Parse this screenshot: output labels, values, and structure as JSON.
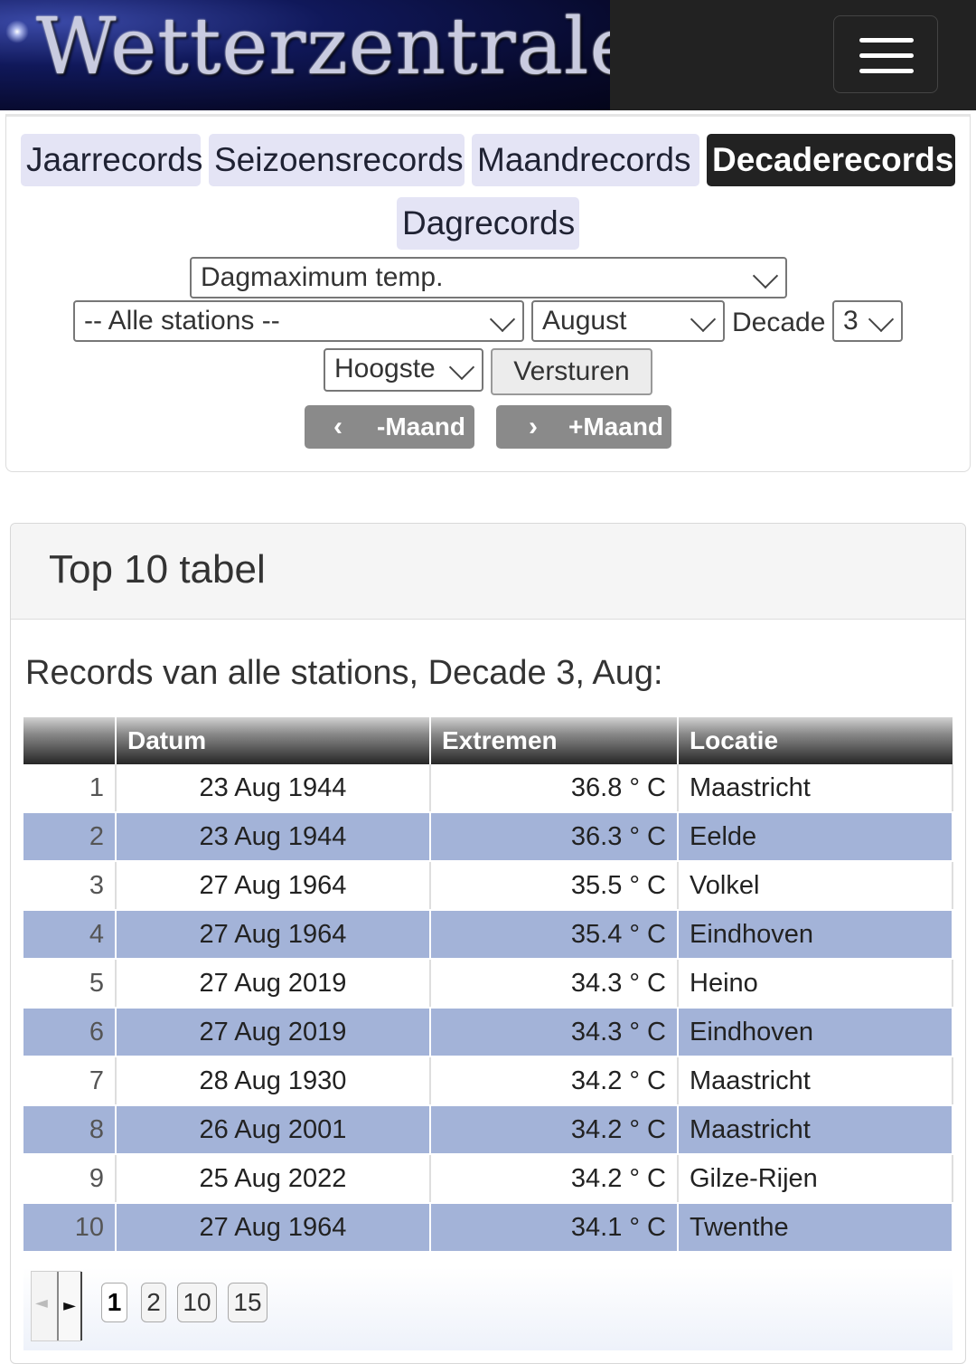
{
  "header": {
    "logo_text": "Wetterzentrale"
  },
  "tabs": [
    "Jaarrecords",
    "Seizoensrecords",
    "Maandrecords",
    "Decaderecords",
    "Dagrecords"
  ],
  "filters": {
    "parameter": "Dagmaximum temp.",
    "station": "-- Alle stations --",
    "month": "August",
    "decade_label": "Decade",
    "decade": "3",
    "order": "Hoogste",
    "submit": "Versturen",
    "prev_month": "-Maand",
    "next_month": "+Maand"
  },
  "panel": {
    "title": "Top 10 tabel",
    "subtitle": "Records van alle stations, Decade 3, Aug:"
  },
  "table": {
    "headers": [
      "",
      "Datum",
      "Extremen",
      "Locatie"
    ],
    "rows": [
      {
        "rank": "1",
        "datum": "23 Aug 1944",
        "value": "36.8 ° C",
        "locatie": "Maastricht"
      },
      {
        "rank": "2",
        "datum": "23 Aug 1944",
        "value": "36.3 ° C",
        "locatie": "Eelde"
      },
      {
        "rank": "3",
        "datum": "27 Aug 1964",
        "value": "35.5 ° C",
        "locatie": "Volkel"
      },
      {
        "rank": "4",
        "datum": "27 Aug 1964",
        "value": "35.4 ° C",
        "locatie": "Eindhoven"
      },
      {
        "rank": "5",
        "datum": "27 Aug 2019",
        "value": "34.3 ° C",
        "locatie": "Heino"
      },
      {
        "rank": "6",
        "datum": "27 Aug 2019",
        "value": "34.3 ° C",
        "locatie": "Eindhoven"
      },
      {
        "rank": "7",
        "datum": "28 Aug 1930",
        "value": "34.2 ° C",
        "locatie": "Maastricht"
      },
      {
        "rank": "8",
        "datum": "26 Aug 2001",
        "value": "34.2 ° C",
        "locatie": "Maastricht"
      },
      {
        "rank": "9",
        "datum": "25 Aug 2022",
        "value": "34.2 ° C",
        "locatie": "Gilze-Rijen"
      },
      {
        "rank": "10",
        "datum": "27 Aug 1964",
        "value": "34.1 ° C",
        "locatie": "Twenthe"
      }
    ]
  },
  "pager": {
    "page_sizes": [
      "1",
      "2",
      "10",
      "15"
    ],
    "current": "1"
  },
  "colors": {
    "alt_row": "#a3b3d8",
    "tab_bg": "#e4e4f5",
    "active_tab": "#222222",
    "header_bg": "#222222"
  }
}
